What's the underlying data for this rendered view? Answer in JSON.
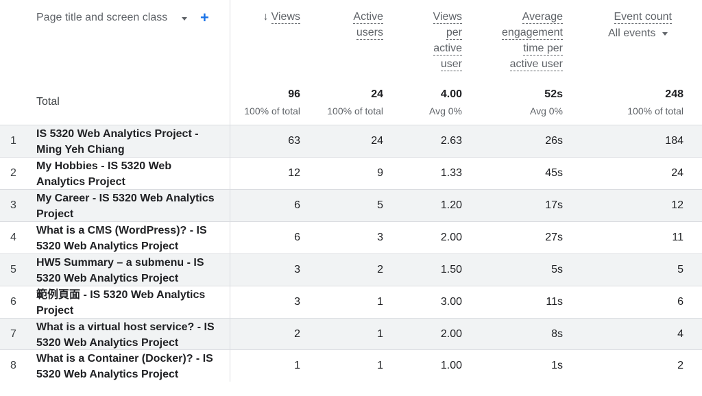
{
  "header": {
    "dimension_label": "Page title and screen class",
    "columns": {
      "views": [
        "Views"
      ],
      "active_users": [
        "Active",
        "users"
      ],
      "views_per_user": [
        "Views",
        "per",
        "active",
        "user"
      ],
      "avg_engagement": [
        "Average",
        "engagement",
        "time per",
        "active user"
      ],
      "event_count": [
        "Event count"
      ]
    },
    "event_filter": "All events",
    "sort_icon": "arrow-down-icon",
    "add_icon": "plus-icon"
  },
  "totals": {
    "label": "Total",
    "views": "96",
    "views_sub": "100% of total",
    "active_users": "24",
    "active_users_sub": "100% of total",
    "views_per_user": "4.00",
    "views_per_user_sub": "Avg 0%",
    "avg_engagement": "52s",
    "avg_engagement_sub": "Avg 0%",
    "event_count": "248",
    "event_count_sub": "100% of total"
  },
  "rows": [
    {
      "idx": "1",
      "title": "IS 5320 Web Analytics Project - Ming Yeh Chiang",
      "views": "63",
      "users": "24",
      "vpu": "2.63",
      "eng": "26s",
      "events": "184"
    },
    {
      "idx": "2",
      "title": "My Hobbies - IS 5320 Web Analytics Project",
      "views": "12",
      "users": "9",
      "vpu": "1.33",
      "eng": "45s",
      "events": "24"
    },
    {
      "idx": "3",
      "title": "My Career - IS 5320 Web Analytics Project",
      "views": "6",
      "users": "5",
      "vpu": "1.20",
      "eng": "17s",
      "events": "12"
    },
    {
      "idx": "4",
      "title": "What is a CMS (WordPress)? - IS 5320 Web Analytics Project",
      "views": "6",
      "users": "3",
      "vpu": "2.00",
      "eng": "27s",
      "events": "11"
    },
    {
      "idx": "5",
      "title": "HW5 Summary – a submenu - IS 5320 Web Analytics Project",
      "views": "3",
      "users": "2",
      "vpu": "1.50",
      "eng": "5s",
      "events": "5"
    },
    {
      "idx": "6",
      "title": "範例頁面 - IS 5320 Web Analytics Project",
      "views": "3",
      "users": "1",
      "vpu": "3.00",
      "eng": "11s",
      "events": "6"
    },
    {
      "idx": "7",
      "title": "What is a virtual host service? - IS 5320 Web Analytics Project",
      "views": "2",
      "users": "1",
      "vpu": "2.00",
      "eng": "8s",
      "events": "4"
    },
    {
      "idx": "8",
      "title": "What is a Container (Docker)? - IS 5320 Web Analytics Project",
      "views": "1",
      "users": "1",
      "vpu": "1.00",
      "eng": "1s",
      "events": "2"
    }
  ],
  "colors": {
    "accent": "#1a73e8",
    "row_shade": "#f1f3f4",
    "divider": "#dadce0"
  }
}
